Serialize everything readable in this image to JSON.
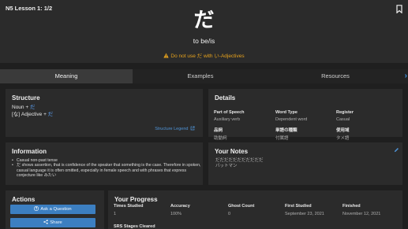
{
  "header": {
    "lesson": "N5 Lesson 1: 1/2",
    "grammar_point": "だ",
    "meaning": "to be/is",
    "warning": "Do not use だ with い-Adjectives"
  },
  "tabs": [
    {
      "label": "Meaning",
      "active": true
    },
    {
      "label": "Examples",
      "active": false
    },
    {
      "label": "Resources",
      "active": false
    }
  ],
  "structure": {
    "title": "Structure",
    "line1_prefix": "Noun + ",
    "line1_hl": "だ",
    "line2_prefix": "[な] Adjective + ",
    "line2_hl": "だ",
    "legend_link": "Structure Legend"
  },
  "details": {
    "title": "Details",
    "columns": [
      {
        "head": "Part of Speech",
        "value": "Auxiliary verb",
        "jhead": "品詞",
        "jvalue": "助動詞"
      },
      {
        "head": "Word Type",
        "value": "Dependent word",
        "jhead": "単語の種類",
        "jvalue": "付属語"
      },
      {
        "head": "Register",
        "value": "Casual",
        "jhead": "使用域",
        "jvalue": "タメ語"
      }
    ]
  },
  "information": {
    "title": "Information",
    "items": [
      "Casual non-past tense",
      "だ shows assertion, that is confidence of the speaker that something is the case. Therefore in spoken, casual language it is often omitted, especially in female speech and with phrases that express conjecture like みたい"
    ]
  },
  "notes": {
    "title": "Your Notes",
    "line1": "だだだだだだだだだだだ",
    "line2": "バットマン"
  },
  "actions": {
    "title": "Actions",
    "ask": "Ask a Question",
    "share": "Share"
  },
  "progress": {
    "title": "Your Progress",
    "columns": [
      {
        "head": "Times Studied",
        "value": "1"
      },
      {
        "head": "Accuracy",
        "value": "100%"
      },
      {
        "head": "Ghost Count",
        "value": "0"
      },
      {
        "head": "First Studied",
        "value": "September 23, 2021"
      },
      {
        "head": "Finished",
        "value": "November 12, 2021"
      }
    ],
    "srs_label": "SRS Stages Cleared"
  },
  "colors": {
    "accent_blue": "#3c7fc1",
    "highlight_blue": "#5ea7ff",
    "warning_orange": "#e6a21d"
  }
}
